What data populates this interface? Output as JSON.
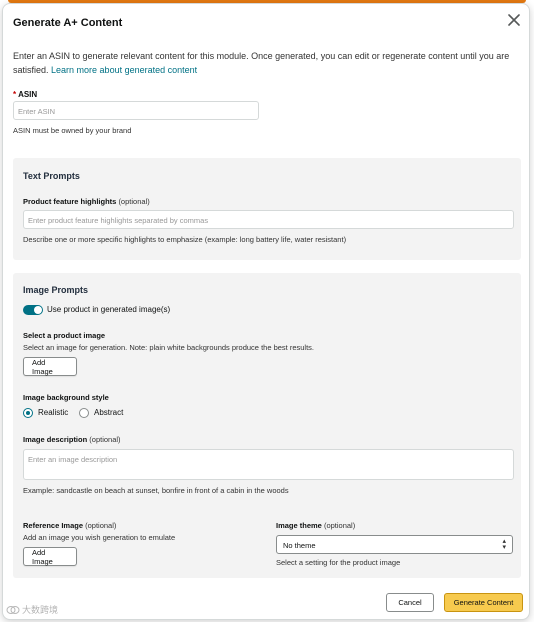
{
  "modal": {
    "title": "Generate A+ Content",
    "intro_text": "Enter an ASIN to generate relevant content for this module. Once generated, you can edit or regenerate content until you are satisfied. ",
    "intro_link": "Learn more about generated content"
  },
  "asin": {
    "required_mark": "*",
    "label": "ASIN",
    "placeholder": "Enter ASIN",
    "hint": "ASIN must be owned by your brand"
  },
  "text_prompts": {
    "title": "Text Prompts",
    "feature_label": "Product feature highlights",
    "feature_optional": "(optional)",
    "feature_placeholder": "Enter product feature highlights separated by commas",
    "feature_hint": "Describe one or more specific highlights to emphasize (example: long battery life, water resistant)"
  },
  "image_prompts": {
    "title": "Image Prompts",
    "toggle_label": "Use product in generated image(s)",
    "toggle_on": true,
    "select_image_label": "Select a product image",
    "select_image_hint": "Select an image for generation. Note: plain white backgrounds produce the best results.",
    "add_image_label": "Add Image",
    "background_label": "Image background style",
    "background_options": [
      "Realistic",
      "Abstract"
    ],
    "background_selected": "Realistic",
    "description_label": "Image description",
    "description_optional": "(optional)",
    "description_placeholder": "Enter an image description",
    "description_hint": "Example: sandcastle on beach at sunset, bonfire in front of a cabin in the woods",
    "reference_label": "Reference Image",
    "reference_optional": "(optional)",
    "reference_hint": "Add an image you wish generation to emulate",
    "reference_button": "Add Image",
    "theme_label": "Image theme",
    "theme_optional": "(optional)",
    "theme_value": "No theme",
    "theme_hint": "Select a setting for the product image"
  },
  "footer": {
    "cancel_label": "Cancel",
    "generate_label": "Generate Content"
  },
  "watermark": {
    "text": "大数跨境"
  },
  "colors": {
    "accent_top": "#e47911",
    "link": "#007185",
    "toggle_on": "#007185",
    "primary_button": "#f7ca4e",
    "required": "#c40000",
    "panel_bg": "#f3f3f3"
  },
  "icons": {
    "close": "close-icon",
    "select_chevron": "chevron-updown-icon",
    "watermark": "watermark-logo-icon"
  }
}
